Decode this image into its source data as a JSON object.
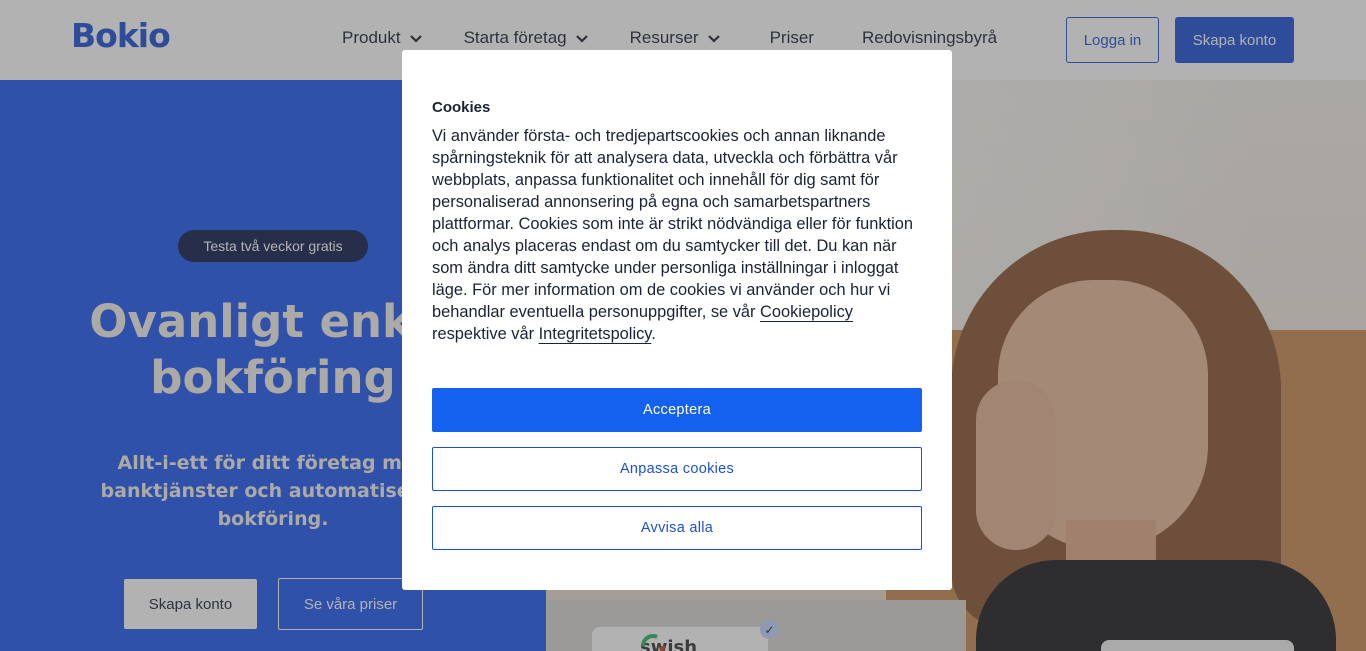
{
  "header": {
    "logo": "Bokio",
    "nav": [
      {
        "label": "Produkt",
        "has_dropdown": true
      },
      {
        "label": "Starta företag",
        "has_dropdown": true
      },
      {
        "label": "Resurser",
        "has_dropdown": true
      },
      {
        "label": "Priser",
        "has_dropdown": false
      },
      {
        "label": "Redovisningsbyrå",
        "has_dropdown": false
      }
    ],
    "login_label": "Logga in",
    "create_account_label": "Skapa konto"
  },
  "hero": {
    "badge": "Testa två veckor gratis",
    "title_line1": "Ovanligt enkel",
    "title_line2": "bokföring",
    "subtitle_line1": "Allt-i-ett för ditt företag med",
    "subtitle_line2": "banktjänster och automatiserad",
    "subtitle_line3": "bokföring.",
    "primary_button": "Skapa konto",
    "secondary_button": "Se våra priser",
    "swish_label": "swish"
  },
  "cookie_dialog": {
    "title": "Cookies",
    "body_text": "Vi använder första- och tredjepartscookies och annan liknande spårningsteknik för att analysera data, utveckla och förbättra vår webbplats, anpassa funktionalitet och innehåll för dig samt för personaliserad annonsering på egna och samarbetspartners plattformar. Cookies som inte är strikt nödvändiga eller för funktion och analys placeras endast om du samtycker till det. Du kan när som ändra ditt samtycke under personliga inställningar i inloggat läge. För mer information om de cookies vi använder och hur vi behandlar eventuella personuppgifter, se vår",
    "cookie_policy_link": "Cookiepolicy",
    "connector": "respektive vår",
    "privacy_policy_link": "Integritetspolicy",
    "end_punct": ".",
    "accept_label": "Acceptera",
    "customize_label": "Anpassa cookies",
    "reject_label": "Avvisa alla"
  },
  "colors": {
    "brand_blue": "#1c50d4",
    "hero_blue": "#1f58f0",
    "accept_blue": "#1461f0",
    "badge_navy": "#0f1d4d"
  }
}
